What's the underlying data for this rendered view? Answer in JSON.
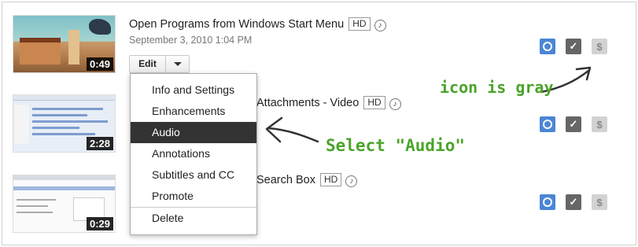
{
  "videos": [
    {
      "title": "Open Programs from Windows Start Menu",
      "hd_badge": "HD",
      "date": "September 3, 2010 1:04 PM",
      "duration": "0:49"
    },
    {
      "title": "Attachments - Video",
      "hd_badge": "HD",
      "duration": "2:28"
    },
    {
      "title": "Search Box",
      "hd_badge": "HD",
      "duration": "0:29"
    }
  ],
  "edit_button": {
    "label": "Edit"
  },
  "menu": {
    "items": [
      "Info and Settings",
      "Enhancements",
      "Audio",
      "Annotations",
      "Subtitles and CC",
      "Promote"
    ],
    "active_item": "Audio",
    "footer_item": "Delete"
  },
  "status_icons": {
    "public": "globe-icon",
    "processed": "check-icon",
    "monetization": "dollar-icon"
  },
  "annotations": {
    "icon_note": "icon is gray",
    "select_note": "Select \"Audio\""
  },
  "colors": {
    "annotation": "#4aa42a",
    "globe": "#4a86d6",
    "check": "#666666",
    "dollar_gray": "#d2d2d2",
    "menu_active": "#333333"
  }
}
